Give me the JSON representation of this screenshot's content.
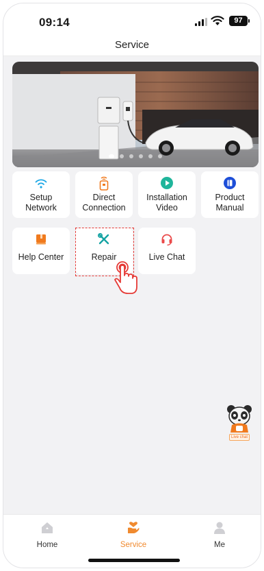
{
  "status_bar": {
    "time": "09:14",
    "battery": "97"
  },
  "header": {
    "title": "Service"
  },
  "banner": {
    "slide_count": 6,
    "active_index": 0
  },
  "services": [
    {
      "label": "Setup Network",
      "icon": "wifi-icon",
      "color": "#1aa7e6"
    },
    {
      "label": "Direct Connection",
      "icon": "device-signal-icon",
      "color": "#f07a1e"
    },
    {
      "label": "Installation Video",
      "icon": "play-icon",
      "color": "#1fb59b"
    },
    {
      "label": "Product Manual",
      "icon": "book-icon",
      "color": "#1d4ed8"
    },
    {
      "label": "Help Center",
      "icon": "folder-icon",
      "color": "#f07a1e"
    },
    {
      "label": "Repair",
      "icon": "tools-icon",
      "color": "#14a3a3"
    },
    {
      "label": "Live Chat",
      "icon": "headset-icon",
      "color": "#ea4a4a"
    }
  ],
  "floating_chat": {
    "label": "Live chat"
  },
  "tabbar": {
    "items": [
      {
        "label": "Home",
        "icon": "house-icon",
        "active": false
      },
      {
        "label": "Service",
        "icon": "heart-hand-icon",
        "active": true
      },
      {
        "label": "Me",
        "icon": "person-icon",
        "active": false
      }
    ]
  },
  "colors": {
    "accent": "#f08a2f",
    "highlight": "#e53935"
  }
}
